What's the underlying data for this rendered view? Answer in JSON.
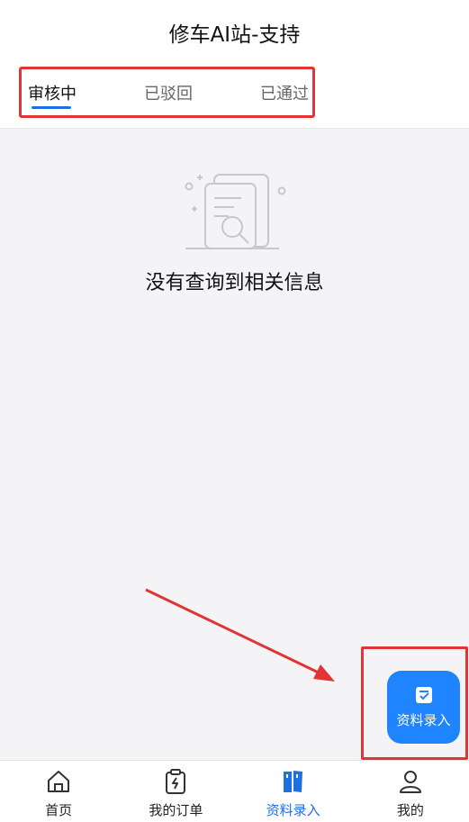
{
  "header": {
    "title": "修车AI站-支持"
  },
  "tabs": [
    {
      "label": "审核中",
      "active": true
    },
    {
      "label": "已驳回",
      "active": false
    },
    {
      "label": "已通过",
      "active": false
    }
  ],
  "empty_state": {
    "message": "没有查询到相关信息",
    "icon": "document-search-icon"
  },
  "fab": {
    "label": "资料录入",
    "icon": "edit-doc-icon"
  },
  "bottom_nav": [
    {
      "label": "首页",
      "icon": "home-icon",
      "active": false
    },
    {
      "label": "我的订单",
      "icon": "clipboard-icon",
      "active": false
    },
    {
      "label": "资料录入",
      "icon": "books-icon",
      "active": true
    },
    {
      "label": "我的",
      "icon": "user-icon",
      "active": false
    }
  ],
  "colors": {
    "accent": "#1e6fe0",
    "fab": "#1e84ff",
    "annotation": "#e23434",
    "background": "#f4f4f6"
  }
}
